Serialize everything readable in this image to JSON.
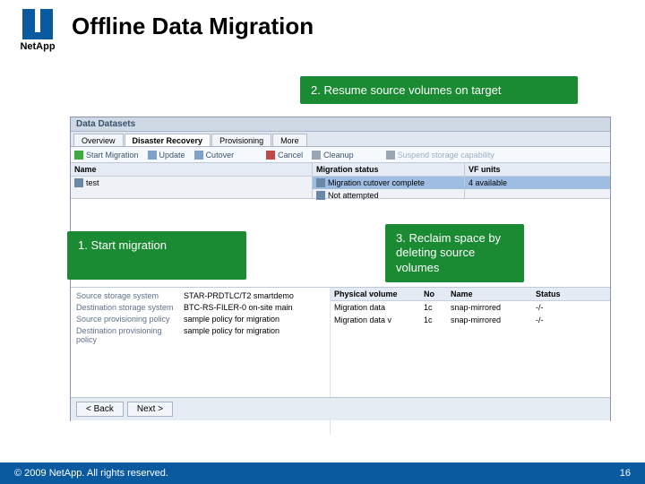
{
  "brand": {
    "name": "NetApp"
  },
  "title": "Offline Data Migration",
  "callouts": {
    "step1": "1. Start migration",
    "step2": "2. Resume source volumes on target",
    "step3": "3. Reclaim space by deleting source volumes"
  },
  "app": {
    "window_title": "Data Datasets",
    "tabs": {
      "t0": "Overview",
      "t1": "Disaster Recovery",
      "t2": "Provisioning",
      "t3": "More"
    },
    "toolbar": {
      "item1": "Start Migration",
      "item2": "Update",
      "item3": "Cutover",
      "item4": "Cancel",
      "item5": "Cleanup",
      "item6": "Suspend storage capability"
    },
    "columns": {
      "name": "Name",
      "migstatus": "Migration status",
      "vfunits": "VF units"
    },
    "row": {
      "name": "test",
      "mig_label": "Migration cutover complete",
      "mig_text": "Not attempted",
      "vf": "4 available"
    },
    "details": {
      "k1": "Source storage system",
      "v1": "STAR-PRDTLC/T2 smartdemo",
      "k2": "Destination storage system",
      "v2": "BTC-RS-FILER-0 on-site main",
      "k3": "Source provisioning policy",
      "v3": "sample policy for migration",
      "k4": "Destination provisioning policy",
      "v4": "sample policy for migration"
    },
    "table": {
      "h_phys": "Physical volume",
      "h_no": "No",
      "h_name": "Name",
      "h_status": "Status",
      "r1_phys": "Migration data",
      "r1_no": "1c",
      "r1_name": "snap-mirrored",
      "r1_status": "-/-",
      "r2_phys": "Migration data v",
      "r2_no": "1c",
      "r2_name": "snap-mirrored",
      "r2_status": "-/-"
    },
    "buttons": {
      "back": "< Back",
      "next": "Next >"
    }
  },
  "footer": {
    "copyright": "© 2009 NetApp.  All rights reserved.",
    "page": "16"
  }
}
